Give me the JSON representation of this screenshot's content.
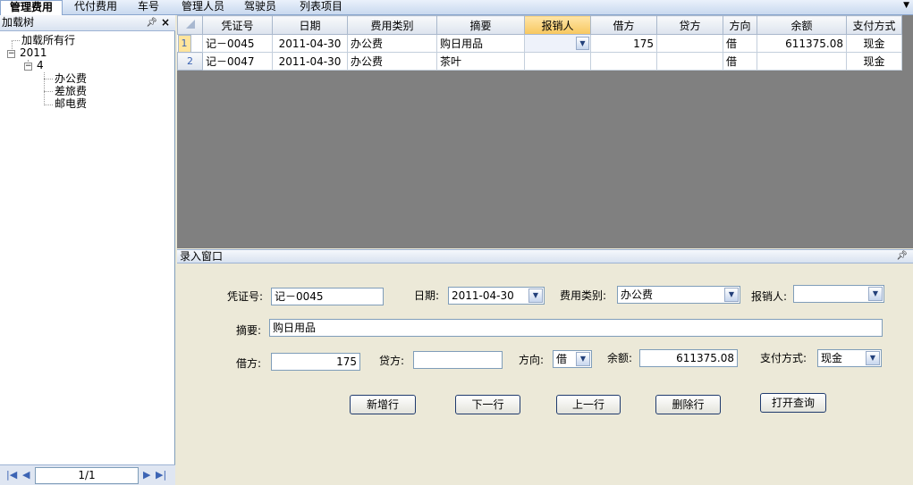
{
  "tabs": [
    {
      "label": "管理费用",
      "active": true
    },
    {
      "label": "代付费用",
      "active": false
    },
    {
      "label": "车号",
      "active": false
    },
    {
      "label": "管理人员",
      "active": false
    },
    {
      "label": "驾驶员",
      "active": false
    },
    {
      "label": "列表项目",
      "active": false
    }
  ],
  "left_panel": {
    "title": "加载树",
    "tree": {
      "load_all": "加载所有行",
      "year": "2011",
      "month": "4",
      "leaves": [
        "办公费",
        "差旅费",
        "邮电费"
      ]
    },
    "pager": {
      "value": "1/1"
    }
  },
  "grid": {
    "columns": [
      "凭证号",
      "日期",
      "费用类别",
      "摘要",
      "报销人",
      "借方",
      "贷方",
      "方向",
      "余额",
      "支付方式"
    ],
    "highlighted_column": "报销人",
    "rows": [
      {
        "rownum": "1",
        "voucher": "记－0045",
        "date": "2011-04-30",
        "category": "办公费",
        "summary": "购日用品",
        "reimburser": "",
        "debit": "175",
        "credit": "",
        "direction": "借",
        "balance": "611375.08",
        "payment": "现金"
      },
      {
        "rownum": "2",
        "voucher": "记－0047",
        "date": "2011-04-30",
        "category": "办公费",
        "summary": "茶叶",
        "reimburser": "",
        "debit": "",
        "credit": "",
        "direction": "借",
        "balance": "",
        "payment": "现金"
      }
    ]
  },
  "entry": {
    "title": "录入窗口",
    "voucher_label": "凭证号:",
    "voucher_value": "记－0045",
    "date_label": "日期:",
    "date_value": "2011-04-30",
    "category_label": "费用类别:",
    "category_value": "办公费",
    "reimburser_label": "报销人:",
    "reimburser_value": "",
    "summary_label": "摘要:",
    "summary_value": "购日用品",
    "debit_label": "借方:",
    "debit_value": "175",
    "credit_label": "贷方:",
    "credit_value": "",
    "direction_label": "方向:",
    "direction_value": "借",
    "balance_label": "余额:",
    "balance_value": "611375.08",
    "payment_label": "支付方式:",
    "payment_value": "现金",
    "buttons": {
      "new_row": "新增行",
      "next_row": "下一行",
      "prev_row": "上一行",
      "delete_row": "删除行",
      "open_query": "打开查询"
    }
  },
  "colors": {
    "tab_bar": "#c9d9ef",
    "grid_background": "#808080",
    "highlight_header": "#f7c75e",
    "form_background": "#ece9d8"
  }
}
